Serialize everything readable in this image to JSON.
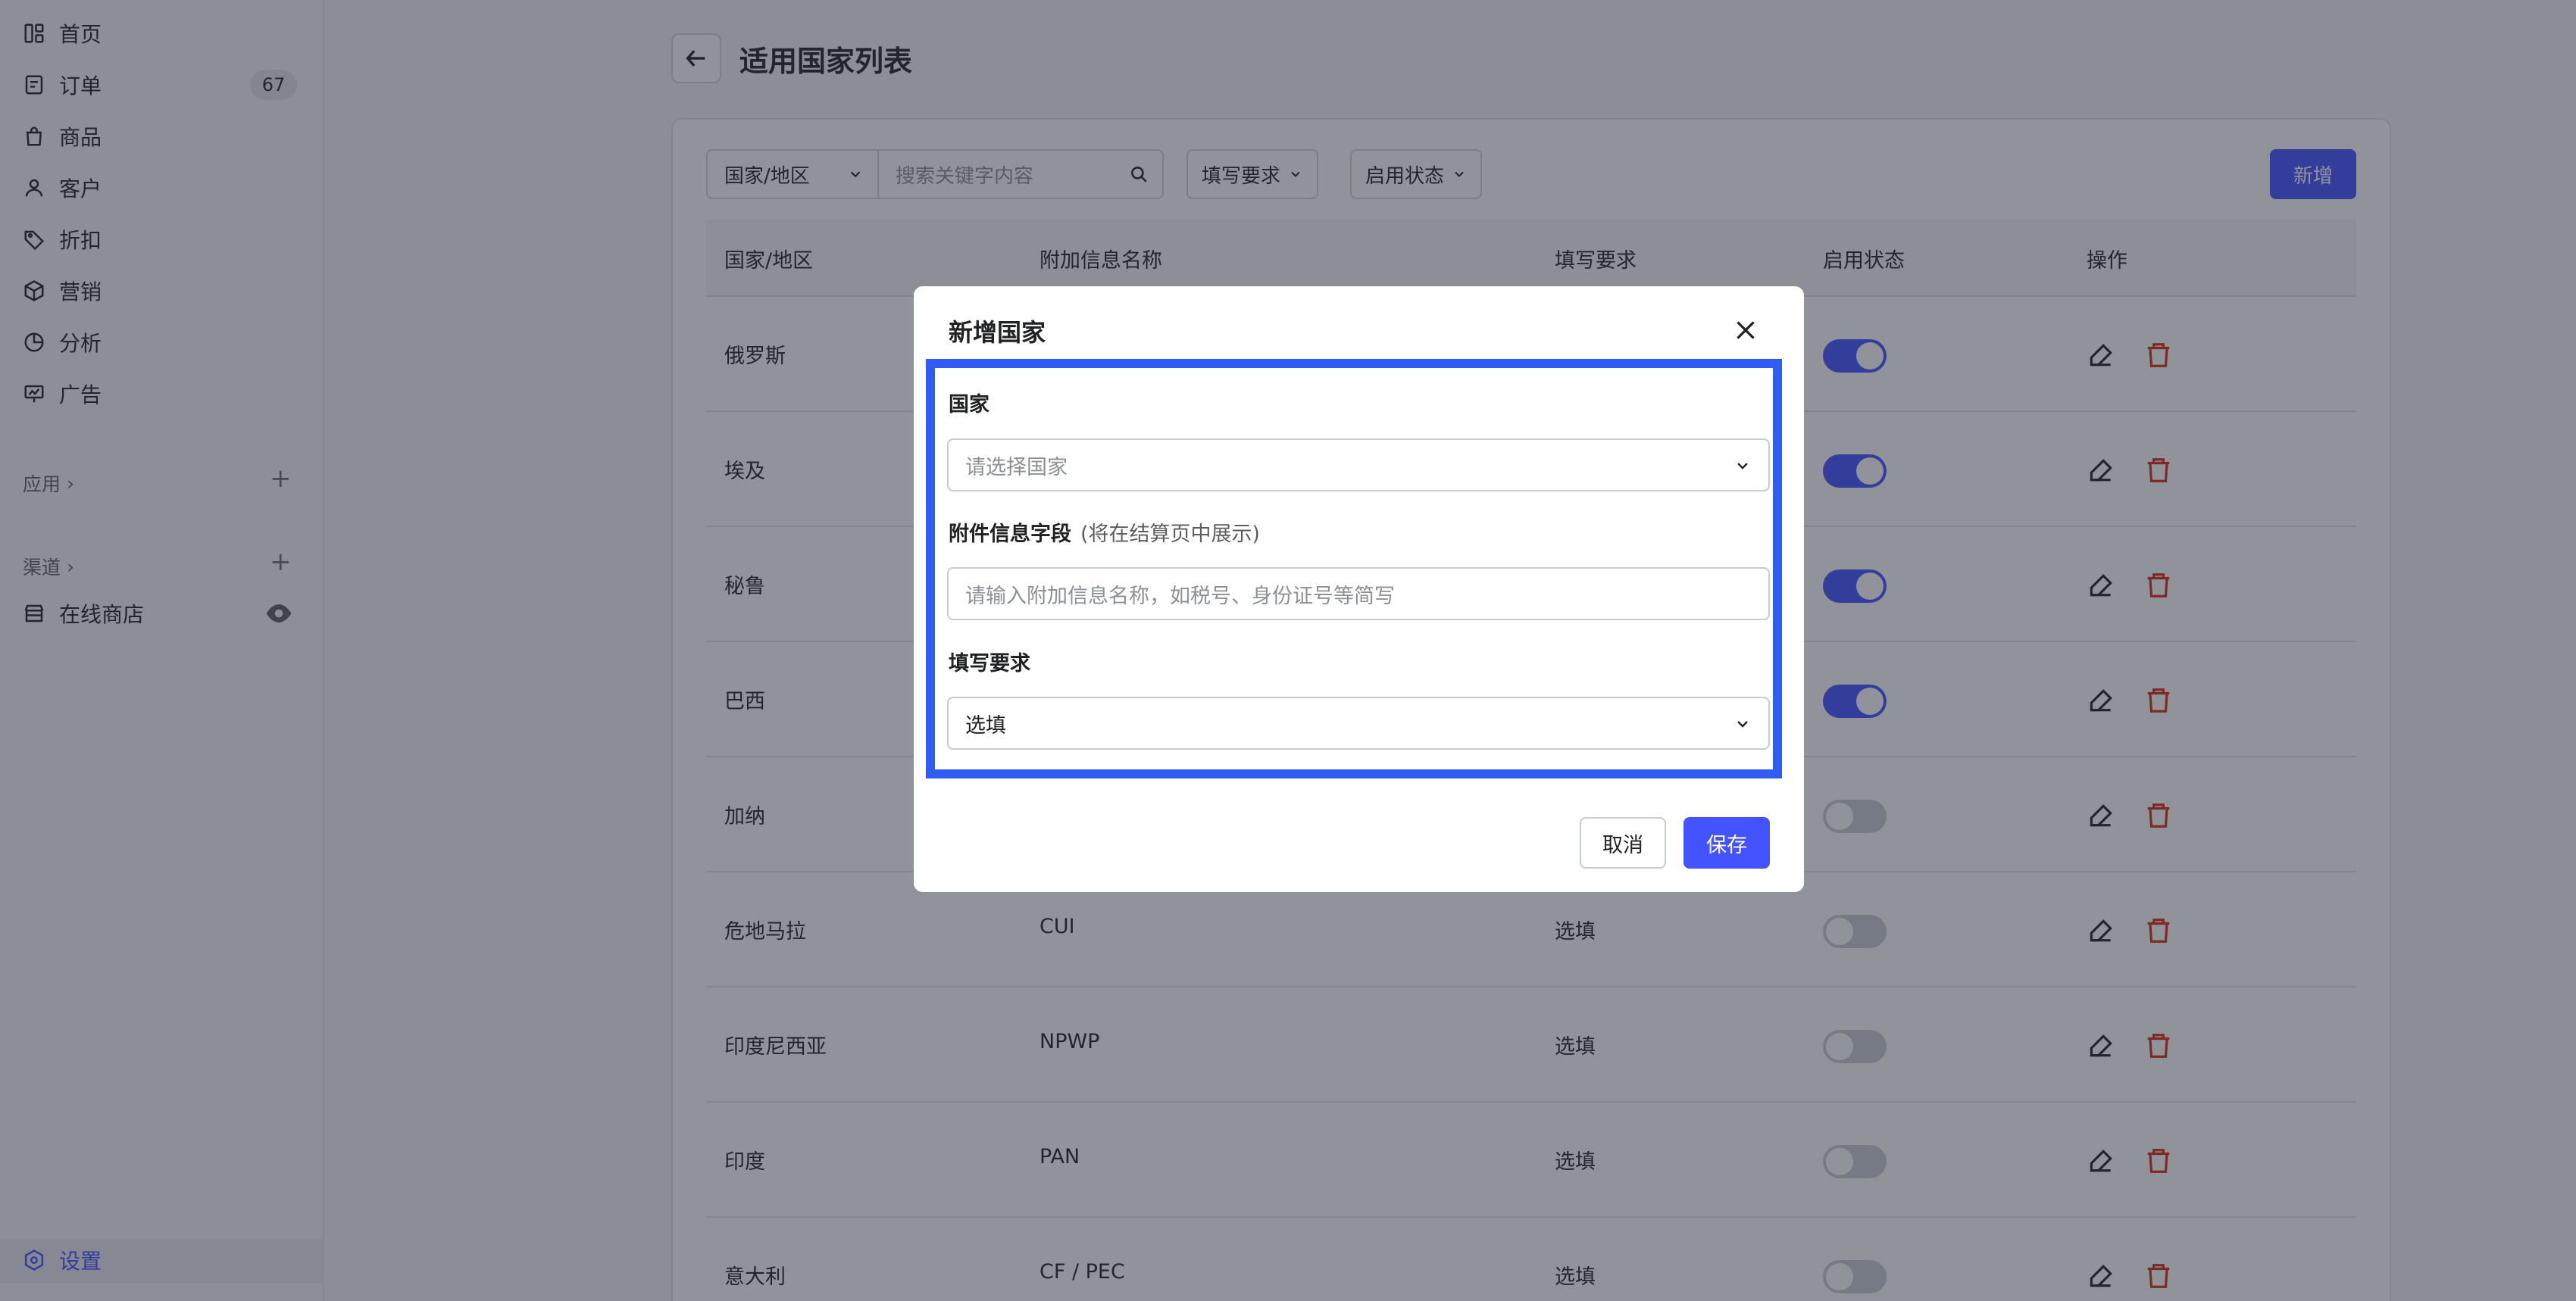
{
  "sidebar": {
    "items": [
      {
        "label": "首页",
        "icon": "home-icon"
      },
      {
        "label": "订单",
        "icon": "orders-icon",
        "badge": "67"
      },
      {
        "label": "商品",
        "icon": "products-icon"
      },
      {
        "label": "客户",
        "icon": "customers-icon"
      },
      {
        "label": "折扣",
        "icon": "discount-icon"
      },
      {
        "label": "营销",
        "icon": "marketing-icon"
      },
      {
        "label": "分析",
        "icon": "analytics-icon"
      },
      {
        "label": "广告",
        "icon": "ads-icon"
      }
    ],
    "apps_label": "应用",
    "channels_label": "渠道",
    "online_store_label": "在线商店",
    "settings_label": "设置"
  },
  "header": {
    "title": "适用国家列表"
  },
  "filters": {
    "country_select": "国家/地区",
    "search_placeholder": "搜索关键字内容",
    "requirement_filter": "填写要求",
    "status_filter": "启用状态",
    "new_button": "新增"
  },
  "table": {
    "columns": [
      "国家/地区",
      "附加信息名称",
      "填写要求",
      "启用状态",
      "操作"
    ],
    "rows": [
      {
        "country": "俄罗斯",
        "field": "",
        "requirement": "",
        "enabled": true
      },
      {
        "country": "埃及",
        "field": "",
        "requirement": "",
        "enabled": true
      },
      {
        "country": "秘鲁",
        "field": "",
        "requirement": "",
        "enabled": true
      },
      {
        "country": "巴西",
        "field": "",
        "requirement": "",
        "enabled": true
      },
      {
        "country": "加纳",
        "field": "",
        "requirement": "",
        "enabled": false
      },
      {
        "country": "危地马拉",
        "field": "CUI",
        "requirement": "选填",
        "enabled": false
      },
      {
        "country": "印度尼西亚",
        "field": "NPWP",
        "requirement": "选填",
        "enabled": false
      },
      {
        "country": "印度",
        "field": "PAN",
        "requirement": "选填",
        "enabled": false
      },
      {
        "country": "意大利",
        "field": "CF / PEC",
        "requirement": "选填",
        "enabled": false
      }
    ]
  },
  "modal": {
    "title": "新增国家",
    "country_label": "国家",
    "country_placeholder": "请选择国家",
    "field_label": "附件信息字段",
    "field_hint": "(将在结算页中展示)",
    "field_placeholder": "请输入附加信息名称，如税号、身份证号等简写",
    "requirement_label": "填写要求",
    "requirement_value": "选填",
    "cancel_label": "取消",
    "save_label": "保存"
  },
  "colors": {
    "accent": "#4353ff",
    "highlight_border": "#2f5cf5",
    "delete": "#d72c0d"
  }
}
